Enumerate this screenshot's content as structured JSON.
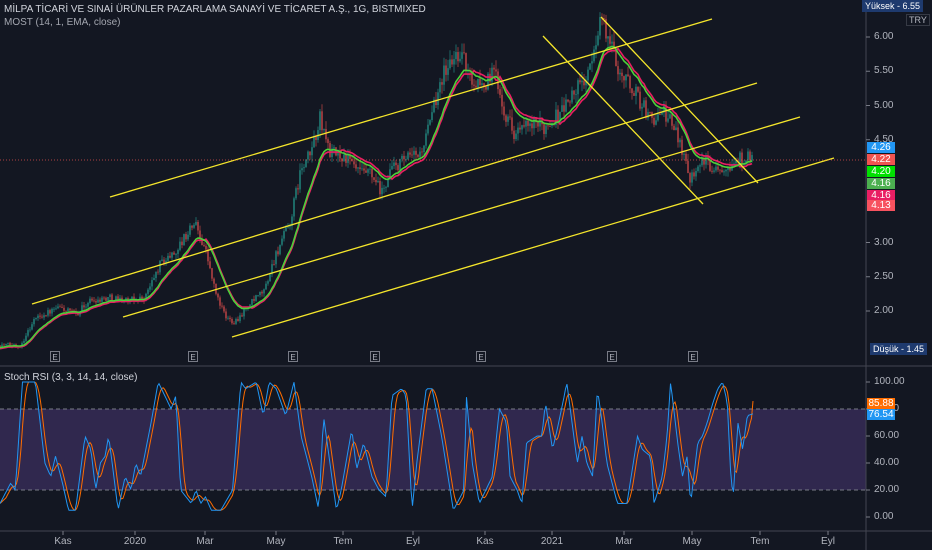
{
  "header": {
    "title": "MİLPA TİCARİ VE SINAİ ÜRÜNLER PAZARLAMA SANAYİ VE TİCARET A.Ş., 1G, BISTMIXED",
    "indicator": "MOST (14, 1, EMA, close)",
    "currency": "TRY"
  },
  "markers": {
    "high_label": "Yüksek",
    "high_value": "6.55",
    "low_label": "Düşük",
    "low_value": "1.45",
    "earnings_label": "E"
  },
  "price_tags": [
    {
      "value": "4.26",
      "color": "#2196f3"
    },
    {
      "value": "4.22",
      "color": "#ef5350"
    },
    {
      "value": "4.20",
      "color": "#00e000"
    },
    {
      "value": "4.16",
      "color": "#4caf50"
    },
    {
      "value": "4.16",
      "color": "#e91e63"
    },
    {
      "value": "4.13",
      "color": "#f7525f"
    }
  ],
  "stoch": {
    "title": "Stoch RSI (3, 3, 14, 14, close)",
    "d_value": "85.88",
    "d_color": "#ff6d00",
    "k_value": "76.54",
    "k_color": "#2196f3"
  },
  "chart_data": [
    {
      "type": "candlestick",
      "title": "MİLPA TİCARİ VE SINAİ ÜRÜNLER PAZARLAMA SANAYİ VE TİCARET A.Ş., 1G, BISTMIXED",
      "x_unit": "days since start (approx. late Sep 2019)",
      "ylabel": "TRY",
      "yticks": [
        "6.00",
        "5.50",
        "5.00",
        "4.50",
        "3.00",
        "2.50",
        "2.00"
      ],
      "ylim": [
        1.4,
        6.55
      ],
      "close_keypoints": [
        [
          0,
          1.5
        ],
        [
          17,
          1.5
        ],
        [
          30,
          1.9
        ],
        [
          51,
          2.05
        ],
        [
          64,
          1.95
        ],
        [
          76,
          2.15
        ],
        [
          93,
          2.2
        ],
        [
          110,
          2.15
        ],
        [
          123,
          2.2
        ],
        [
          136,
          2.7
        ],
        [
          148,
          2.85
        ],
        [
          165,
          3.3
        ],
        [
          174,
          2.9
        ],
        [
          182,
          2.3
        ],
        [
          191,
          1.9
        ],
        [
          199,
          1.85
        ],
        [
          212,
          2.1
        ],
        [
          224,
          2.3
        ],
        [
          233,
          2.8
        ],
        [
          246,
          3.3
        ],
        [
          254,
          4.0
        ],
        [
          263,
          4.3
        ],
        [
          271,
          4.8
        ],
        [
          280,
          4.3
        ],
        [
          292,
          4.25
        ],
        [
          305,
          4.0
        ],
        [
          313,
          4.0
        ],
        [
          324,
          3.7
        ],
        [
          330,
          4.05
        ],
        [
          343,
          4.2
        ],
        [
          356,
          4.3
        ],
        [
          364,
          4.7
        ],
        [
          373,
          5.4
        ],
        [
          381,
          5.6
        ],
        [
          390,
          5.8
        ],
        [
          398,
          5.4
        ],
        [
          411,
          5.3
        ],
        [
          419,
          5.5
        ],
        [
          428,
          4.9
        ],
        [
          436,
          4.6
        ],
        [
          449,
          4.7
        ],
        [
          462,
          4.7
        ],
        [
          474,
          4.9
        ],
        [
          487,
          5.2
        ],
        [
          500,
          5.5
        ],
        [
          508,
          6.3
        ],
        [
          517,
          5.9
        ],
        [
          525,
          5.5
        ],
        [
          538,
          5.2
        ],
        [
          551,
          4.8
        ],
        [
          563,
          4.9
        ],
        [
          576,
          4.5
        ],
        [
          584,
          3.95
        ],
        [
          593,
          4.2
        ],
        [
          606,
          4.1
        ],
        [
          618,
          4.15
        ],
        [
          631,
          4.25
        ],
        [
          637,
          4.22
        ]
      ],
      "last_close": 4.22,
      "xticks": [
        "Kas",
        "2020",
        "Mar",
        "May",
        "Tem",
        "Eyl",
        "Kas",
        "2021",
        "Mar",
        "May",
        "Tem",
        "Eyl"
      ]
    },
    {
      "type": "line",
      "title": "Stoch RSI (3, 3, 14, 14, close)",
      "ylim": [
        -5,
        105
      ],
      "yticks": [
        "100.00",
        "80.00",
        "60.00",
        "40.00",
        "20.00",
        "0.00"
      ],
      "bands": [
        20,
        80
      ],
      "k_keypoints": [
        [
          0,
          10
        ],
        [
          9,
          25
        ],
        [
          13,
          20
        ],
        [
          19,
          100
        ],
        [
          30,
          100
        ],
        [
          38,
          40
        ],
        [
          43,
          30
        ],
        [
          47,
          45
        ],
        [
          53,
          25
        ],
        [
          58,
          5
        ],
        [
          64,
          5
        ],
        [
          72,
          60
        ],
        [
          77,
          50
        ],
        [
          81,
          20
        ],
        [
          85,
          40
        ],
        [
          89,
          45
        ],
        [
          92,
          60
        ],
        [
          95,
          40
        ],
        [
          100,
          5
        ],
        [
          106,
          30
        ],
        [
          111,
          20
        ],
        [
          115,
          40
        ],
        [
          119,
          30
        ],
        [
          128,
          70
        ],
        [
          134,
          100
        ],
        [
          145,
          80
        ],
        [
          149,
          90
        ],
        [
          153,
          20
        ],
        [
          162,
          10
        ],
        [
          166,
          20
        ],
        [
          170,
          10
        ],
        [
          174,
          15
        ],
        [
          179,
          5
        ],
        [
          187,
          5
        ],
        [
          197,
          20
        ],
        [
          204,
          100
        ],
        [
          208,
          95
        ],
        [
          217,
          100
        ],
        [
          223,
          75
        ],
        [
          228,
          100
        ],
        [
          234,
          95
        ],
        [
          242,
          75
        ],
        [
          249,
          100
        ],
        [
          255,
          60
        ],
        [
          264,
          30
        ],
        [
          270,
          5
        ],
        [
          274,
          75
        ],
        [
          281,
          30
        ],
        [
          285,
          5
        ],
        [
          289,
          20
        ],
        [
          298,
          65
        ],
        [
          302,
          35
        ],
        [
          308,
          55
        ],
        [
          315,
          30
        ],
        [
          321,
          20
        ],
        [
          327,
          15
        ],
        [
          332,
          90
        ],
        [
          340,
          95
        ],
        [
          344,
          90
        ],
        [
          349,
          5
        ],
        [
          353,
          40
        ],
        [
          361,
          95
        ],
        [
          366,
          95
        ],
        [
          374,
          60
        ],
        [
          384,
          5
        ],
        [
          393,
          20
        ],
        [
          395,
          90
        ],
        [
          400,
          40
        ],
        [
          406,
          10
        ],
        [
          417,
          30
        ],
        [
          423,
          80
        ],
        [
          429,
          70
        ],
        [
          432,
          30
        ],
        [
          438,
          20
        ],
        [
          442,
          10
        ],
        [
          446,
          55
        ],
        [
          455,
          60
        ],
        [
          459,
          60
        ],
        [
          462,
          85
        ],
        [
          468,
          50
        ],
        [
          472,
          65
        ],
        [
          478,
          90
        ],
        [
          480,
          100
        ],
        [
          489,
          40
        ],
        [
          493,
          60
        ],
        [
          497,
          40
        ],
        [
          502,
          30
        ],
        [
          506,
          95
        ],
        [
          510,
          70
        ],
        [
          514,
          40
        ],
        [
          523,
          10
        ],
        [
          531,
          10
        ],
        [
          540,
          60
        ],
        [
          544,
          50
        ],
        [
          551,
          45
        ],
        [
          554,
          10
        ],
        [
          561,
          30
        ],
        [
          565,
          60
        ],
        [
          568,
          100
        ],
        [
          574,
          55
        ],
        [
          578,
          30
        ],
        [
          582,
          45
        ],
        [
          585,
          10
        ],
        [
          591,
          55
        ],
        [
          595,
          60
        ],
        [
          599,
          70
        ],
        [
          604,
          85
        ],
        [
          608,
          95
        ],
        [
          612,
          100
        ],
        [
          616,
          85
        ],
        [
          619,
          30
        ],
        [
          621,
          15
        ],
        [
          625,
          70
        ],
        [
          629,
          50
        ],
        [
          633,
          75
        ],
        [
          638,
          76.54
        ]
      ],
      "last_k": 76.54,
      "last_d": 85.88
    }
  ]
}
